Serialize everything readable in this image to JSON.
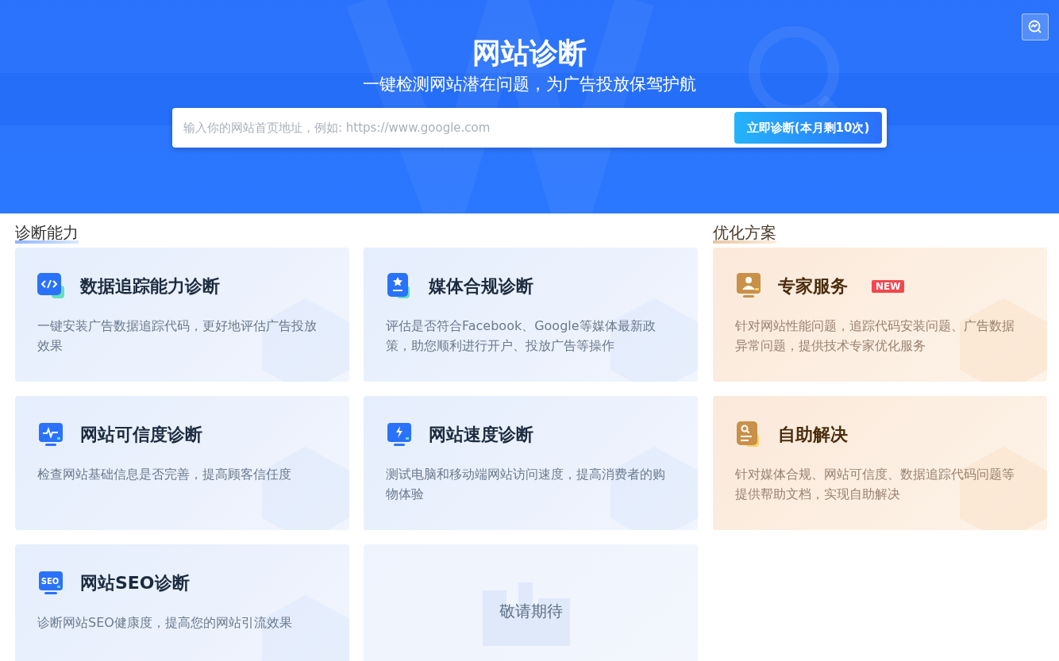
{
  "header": {
    "title": "网站诊断",
    "subtitle": "一键检测网站潜在问题，为广告投放保驾护航",
    "search": {
      "placeholder": "输入你的网站首页地址，例如: https://www.google.com"
    },
    "submit_button": "立即诊断(本月剩10次)"
  },
  "sections": [
    {
      "title": "诊断能力",
      "cards": [
        {
          "kind": "feature",
          "title": "数据追踪能力诊断",
          "description": "一键安装广告数据追踪代码，更好地评估广告投放效果"
        },
        {
          "kind": "feature",
          "title": "媒体合规诊断",
          "description": "评估是否符合Facebook、Google等媒体最新政策，助您顺利进行开户、投放广告等操作"
        },
        {
          "kind": "feature",
          "title": "网站可信度诊断",
          "description": "检查网站基础信息是否完善，提高顾客信任度"
        },
        {
          "kind": "feature",
          "title": "网站速度诊断",
          "description": "测试电脑和移动端网站访问速度，提高消费者的购物体验"
        },
        {
          "kind": "feature",
          "icon_text": "SEO",
          "title": "网站SEO诊断",
          "description": "诊断网站SEO健康度，提高您的网站引流效果"
        },
        {
          "kind": "placeholder",
          "label": "敬请期待"
        }
      ]
    },
    {
      "title": "优化方案",
      "cards": [
        {
          "kind": "feature",
          "title": "专家服务",
          "badge": "NEW",
          "description": "针对网站性能问题，追踪代码安装问题、广告数据异常问题，提供技术专家优化服务"
        },
        {
          "kind": "feature",
          "title": "自助解决",
          "description": "针对媒体合规、网站可信度、数据追踪代码问题等提供帮助文档，实现自助解决"
        }
      ]
    }
  ]
}
